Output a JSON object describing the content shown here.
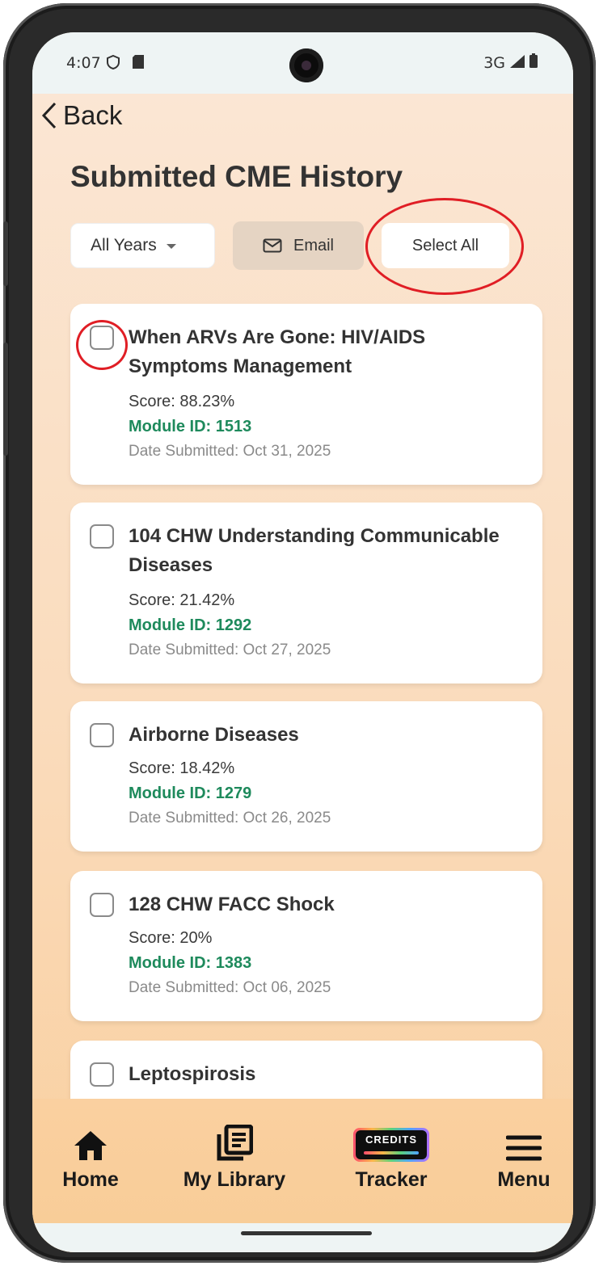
{
  "status_bar": {
    "time": "4:07",
    "network": "3G"
  },
  "header": {
    "back_label": "Back",
    "title": "Submitted CME History"
  },
  "toolbar": {
    "year_filter": "All Years",
    "email_label": "Email",
    "select_all_label": "Select All"
  },
  "records": [
    {
      "title": "When ARVs Are Gone: HIV/AIDS Symptoms Management",
      "score": "Score: 88.23%",
      "module_id": "Module ID: 1513",
      "date": "Date Submitted: Oct 31, 2025"
    },
    {
      "title": "104 CHW Understanding Communicable Diseases",
      "score": "Score: 21.42%",
      "module_id": "Module ID: 1292",
      "date": "Date Submitted: Oct 27, 2025"
    },
    {
      "title": "Airborne Diseases",
      "score": "Score: 18.42%",
      "module_id": "Module ID: 1279",
      "date": "Date Submitted: Oct 26, 2025"
    },
    {
      "title": "128 CHW FACC Shock",
      "score": "Score: 20%",
      "module_id": "Module ID: 1383",
      "date": "Date Submitted: Oct 06, 2025"
    },
    {
      "title": "Leptospirosis"
    }
  ],
  "bottom_nav": {
    "home": "Home",
    "library": "My Library",
    "tracker_badge": "CREDITS",
    "tracker": "Tracker",
    "menu": "Menu"
  },
  "colors": {
    "module_id": "#1e8a5c",
    "annotation_ring": "#e01e25",
    "email_bg": "#e5d4c3"
  }
}
